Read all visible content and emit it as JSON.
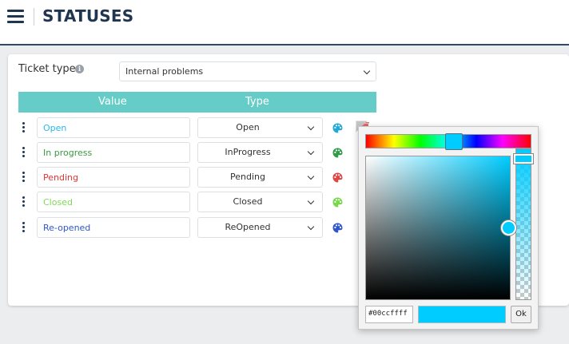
{
  "header": {
    "title": "STATUSES"
  },
  "ticket_type": {
    "label": "Ticket type",
    "selected": "Internal problems"
  },
  "table": {
    "columns": [
      "Value",
      "Type"
    ],
    "rows": [
      {
        "value": "Open",
        "value_color": "#2ab7e8",
        "type": "Open",
        "palette_color": "#1fa9d6"
      },
      {
        "value": "In progress",
        "value_color": "#3a9a3e",
        "type": "InProgress",
        "palette_color": "#2e9b47"
      },
      {
        "value": "Pending",
        "value_color": "#e03535",
        "type": "Pending",
        "palette_color": "#e04545"
      },
      {
        "value": "Closed",
        "value_color": "#7ed957",
        "type": "Closed",
        "palette_color": "#77d84a"
      },
      {
        "value": "Re-opened",
        "value_color": "#2d56c9",
        "type": "ReOpened",
        "palette_color": "#2d56c9"
      }
    ]
  },
  "color_picker": {
    "hex_value": "#00ccffff",
    "current_color": "#00ccff",
    "ok_label": "Ok"
  },
  "icons": {
    "menu": "hamburger-icon",
    "info": "info-icon",
    "row_drag": "drag-handle-icon",
    "row_color": "palette-icon",
    "row_delete": "trash-icon"
  }
}
